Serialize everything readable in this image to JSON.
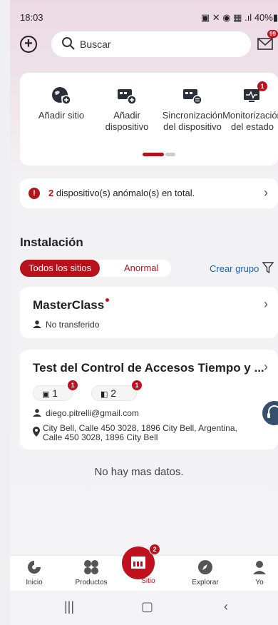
{
  "status": {
    "time": "18:03",
    "battery": "40%"
  },
  "header": {
    "search_placeholder": "Buscar",
    "mail_badge": "99"
  },
  "quick_actions": [
    {
      "label1": "Añadir sitio",
      "label2": "",
      "icon": "add-site-icon"
    },
    {
      "label1": "Añadir",
      "label2": "dispositivo",
      "icon": "add-device-icon"
    },
    {
      "label1": "Sincronización",
      "label2": "del dispositivo",
      "icon": "sync-device-icon"
    },
    {
      "label1": "Monitorización",
      "label2": "del estado",
      "icon": "monitor-status-icon",
      "badge": "1"
    }
  ],
  "alert": {
    "count": "2",
    "text": " dispositivo(s) anómalo(s) en total."
  },
  "section": {
    "title": "Instalación"
  },
  "tabs": {
    "all": "Todos los sitios",
    "abnormal": "Anormal"
  },
  "create_group": "Crear grupo",
  "sites": [
    {
      "name": "MasterClass",
      "owner": "No transferido"
    },
    {
      "name": "Test del Control de Accesos Tiempo y ...",
      "device_count_1": "1",
      "device_badge_1": "1",
      "device_count_2": "2",
      "device_badge_2": "1",
      "owner": "diego.pitrelli@gmail.com",
      "address_line1": "City Bell, Calle 450 3028, 1896 City Bell, Argentina,",
      "address_line2": "Calle 450 3028,  1896 City Bell"
    }
  ],
  "footer_text": "No hay mas datos.",
  "bottom_nav": [
    {
      "label": "Inicio",
      "icon": "home-icon"
    },
    {
      "label": "Productos",
      "icon": "products-icon"
    },
    {
      "label": "Sitio",
      "icon": "site-icon",
      "badge": "2"
    },
    {
      "label": "Explorar",
      "icon": "explore-icon"
    },
    {
      "label": "Yo",
      "icon": "profile-icon"
    }
  ],
  "colors": {
    "accent": "#b5121b",
    "link": "#1c5fb8"
  }
}
